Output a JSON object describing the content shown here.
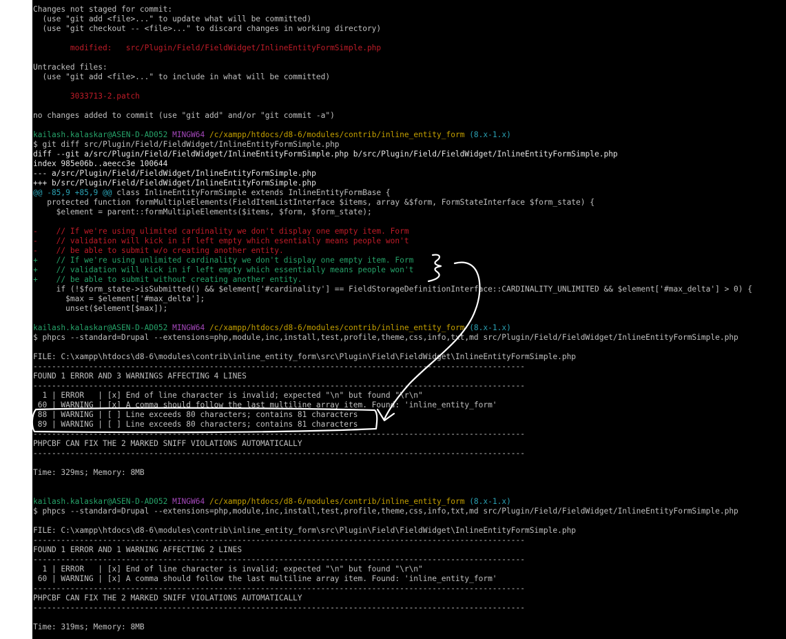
{
  "colors": {
    "background": "#000000",
    "default": "#c0c0c0",
    "red": "#c01c28",
    "green": "#26a269",
    "cyan": "#2aa1b3",
    "magenta": "#a347ba",
    "yellow": "#c4a000",
    "white": "#e6e6e6",
    "annotation": "#ffffff"
  },
  "lines": [
    {
      "segments": [
        {
          "text": "Changes not staged for commit:",
          "color": "default"
        }
      ]
    },
    {
      "segments": [
        {
          "text": "  (use \"git add <file>...\" to update what will be committed)",
          "color": "default"
        }
      ]
    },
    {
      "segments": [
        {
          "text": "  (use \"git checkout -- <file>...\" to discard changes in working directory)",
          "color": "default"
        }
      ]
    },
    {
      "segments": []
    },
    {
      "segments": [
        {
          "text": "        modified:   src/Plugin/Field/FieldWidget/InlineEntityFormSimple.php",
          "color": "red"
        }
      ]
    },
    {
      "segments": []
    },
    {
      "segments": [
        {
          "text": "Untracked files:",
          "color": "default"
        }
      ]
    },
    {
      "segments": [
        {
          "text": "  (use \"git add <file>...\" to include in what will be committed)",
          "color": "default"
        }
      ]
    },
    {
      "segments": []
    },
    {
      "segments": [
        {
          "text": "        3033713-2.patch",
          "color": "red"
        }
      ]
    },
    {
      "segments": []
    },
    {
      "segments": [
        {
          "text": "no changes added to commit (use \"git add\" and/or \"git commit -a\")",
          "color": "default"
        }
      ]
    },
    {
      "segments": []
    },
    {
      "segments": [
        {
          "text": "kailash.kalaskar@ASEN-D-AD052",
          "color": "green"
        },
        {
          "text": " ",
          "color": "default"
        },
        {
          "text": "MINGW64",
          "color": "magenta"
        },
        {
          "text": " ",
          "color": "default"
        },
        {
          "text": "/c/xampp/htdocs/d8-6/modules/contrib/inline_entity_form",
          "color": "yellow"
        },
        {
          "text": " ",
          "color": "default"
        },
        {
          "text": "(8.x-1.x)",
          "color": "cyan"
        }
      ]
    },
    {
      "segments": [
        {
          "text": "$ git diff src/Plugin/Field/FieldWidget/InlineEntityFormSimple.php",
          "color": "default"
        }
      ]
    },
    {
      "segments": [
        {
          "text": "diff --git a/src/Plugin/Field/FieldWidget/InlineEntityFormSimple.php b/src/Plugin/Field/FieldWidget/InlineEntityFormSimple.php",
          "color": "white"
        }
      ]
    },
    {
      "segments": [
        {
          "text": "index 985e06b..aeecc3e 100644",
          "color": "white"
        }
      ]
    },
    {
      "segments": [
        {
          "text": "--- a/src/Plugin/Field/FieldWidget/InlineEntityFormSimple.php",
          "color": "white"
        }
      ]
    },
    {
      "segments": [
        {
          "text": "+++ b/src/Plugin/Field/FieldWidget/InlineEntityFormSimple.php",
          "color": "white"
        }
      ]
    },
    {
      "segments": [
        {
          "text": "@@ -85,9 +85,9 @@",
          "color": "cyan"
        },
        {
          "text": " class InlineEntityFormSimple extends InlineEntityFormBase {",
          "color": "default"
        }
      ]
    },
    {
      "segments": [
        {
          "text": "   protected function formMultipleElements(FieldItemListInterface $items, array &$form, FormStateInterface $form_state) {",
          "color": "default"
        }
      ]
    },
    {
      "segments": [
        {
          "text": "     $element = parent::formMultipleElements($items, $form, $form_state);",
          "color": "default"
        }
      ]
    },
    {
      "segments": []
    },
    {
      "segments": [
        {
          "text": "-    // If we're using ulimited cardinality we don't display one empty item. Form",
          "color": "red"
        }
      ]
    },
    {
      "segments": [
        {
          "text": "-    // validation will kick in if left empty which esentially means people won't",
          "color": "red"
        }
      ]
    },
    {
      "segments": [
        {
          "text": "-    // be able to submit w/o creating another entity.",
          "color": "red"
        }
      ]
    },
    {
      "segments": [
        {
          "text": "+    // If we're using unlimited cardinality we don't display one empty item. Form",
          "color": "green"
        }
      ]
    },
    {
      "segments": [
        {
          "text": "+    // validation will kick in if left empty which essentially means people won't",
          "color": "green"
        }
      ]
    },
    {
      "segments": [
        {
          "text": "+    // be able to submit without creating another entity.",
          "color": "green"
        }
      ]
    },
    {
      "segments": [
        {
          "text": "     if (!$form_state->isSubmitted() && $element['#cardinality'] == FieldStorageDefinitionInterface::CARDINALITY_UNLIMITED && $element['#max_delta'] > 0) {",
          "color": "default"
        }
      ]
    },
    {
      "segments": [
        {
          "text": "       $max = $element['#max_delta'];",
          "color": "default"
        }
      ]
    },
    {
      "segments": [
        {
          "text": "       unset($element[$max]);",
          "color": "default"
        }
      ]
    },
    {
      "segments": []
    },
    {
      "segments": [
        {
          "text": "kailash.kalaskar@ASEN-D-AD052",
          "color": "green"
        },
        {
          "text": " ",
          "color": "default"
        },
        {
          "text": "MINGW64",
          "color": "magenta"
        },
        {
          "text": " ",
          "color": "default"
        },
        {
          "text": "/c/xampp/htdocs/d8-6/modules/contrib/inline_entity_form",
          "color": "yellow"
        },
        {
          "text": " ",
          "color": "default"
        },
        {
          "text": "(8.x-1.x)",
          "color": "cyan"
        }
      ]
    },
    {
      "segments": [
        {
          "text": "$ phpcs --standard=Drupal --extensions=php,module,inc,install,test,profile,theme,css,info,txt,md src/Plugin/Field/FieldWidget/InlineEntityFormSimple.php",
          "color": "default"
        }
      ]
    },
    {
      "segments": []
    },
    {
      "segments": [
        {
          "text": "FILE: C:\\xampp\\htdocs\\d8-6\\modules\\contrib\\inline_entity_form\\src\\Plugin\\Field\\FieldWidget\\InlineEntityFormSimple.php",
          "color": "default"
        }
      ]
    },
    {
      "segments": [
        {
          "text": "----------------------------------------------------------------------------------------------------------",
          "color": "default"
        }
      ]
    },
    {
      "segments": [
        {
          "text": "FOUND 1 ERROR AND 3 WARNINGS AFFECTING 4 LINES",
          "color": "default"
        }
      ]
    },
    {
      "segments": [
        {
          "text": "----------------------------------------------------------------------------------------------------------",
          "color": "default"
        }
      ]
    },
    {
      "segments": [
        {
          "text": "  1 | ERROR   | [x] End of line character is invalid; expected \"\\n\" but found \"\\r\\n\"",
          "color": "default"
        }
      ]
    },
    {
      "segments": [
        {
          "text": " 60 | WARNING | [x] A comma should follow the last multiline array item. Found: 'inline_entity_form'",
          "color": "default"
        }
      ]
    },
    {
      "segments": [
        {
          "text": " 88 | WARNING | [ ] Line exceeds 80 characters; contains 81 characters",
          "color": "default"
        }
      ]
    },
    {
      "segments": [
        {
          "text": " 89 | WARNING | [ ] Line exceeds 80 characters; contains 81 characters",
          "color": "default"
        }
      ]
    },
    {
      "segments": [
        {
          "text": "----------------------------------------------------------------------------------------------------------",
          "color": "default"
        }
      ]
    },
    {
      "segments": [
        {
          "text": "PHPCBF CAN FIX THE 2 MARKED SNIFF VIOLATIONS AUTOMATICALLY",
          "color": "default"
        }
      ]
    },
    {
      "segments": [
        {
          "text": "----------------------------------------------------------------------------------------------------------",
          "color": "default"
        }
      ]
    },
    {
      "segments": []
    },
    {
      "segments": [
        {
          "text": "Time: 329ms; Memory: 8MB",
          "color": "default"
        }
      ]
    },
    {
      "segments": []
    },
    {
      "segments": []
    },
    {
      "segments": [
        {
          "text": "kailash.kalaskar@ASEN-D-AD052",
          "color": "green"
        },
        {
          "text": " ",
          "color": "default"
        },
        {
          "text": "MINGW64",
          "color": "magenta"
        },
        {
          "text": " ",
          "color": "default"
        },
        {
          "text": "/c/xampp/htdocs/d8-6/modules/contrib/inline_entity_form",
          "color": "yellow"
        },
        {
          "text": " ",
          "color": "default"
        },
        {
          "text": "(8.x-1.x)",
          "color": "cyan"
        }
      ]
    },
    {
      "segments": [
        {
          "text": "$ phpcs --standard=Drupal --extensions=php,module,inc,install,test,profile,theme,css,info,txt,md src/Plugin/Field/FieldWidget/InlineEntityFormSimple.php",
          "color": "default"
        }
      ]
    },
    {
      "segments": []
    },
    {
      "segments": [
        {
          "text": "FILE: C:\\xampp\\htdocs\\d8-6\\modules\\contrib\\inline_entity_form\\src\\Plugin\\Field\\FieldWidget\\InlineEntityFormSimple.php",
          "color": "default"
        }
      ]
    },
    {
      "segments": [
        {
          "text": "----------------------------------------------------------------------------------------------------------",
          "color": "default"
        }
      ]
    },
    {
      "segments": [
        {
          "text": "FOUND 1 ERROR AND 1 WARNING AFFECTING 2 LINES",
          "color": "default"
        }
      ]
    },
    {
      "segments": [
        {
          "text": "----------------------------------------------------------------------------------------------------------",
          "color": "default"
        }
      ]
    },
    {
      "segments": [
        {
          "text": "  1 | ERROR   | [x] End of line character is invalid; expected \"\\n\" but found \"\\r\\n\"",
          "color": "default"
        }
      ]
    },
    {
      "segments": [
        {
          "text": " 60 | WARNING | [x] A comma should follow the last multiline array item. Found: 'inline_entity_form'",
          "color": "default"
        }
      ]
    },
    {
      "segments": [
        {
          "text": "----------------------------------------------------------------------------------------------------------",
          "color": "default"
        }
      ]
    },
    {
      "segments": [
        {
          "text": "PHPCBF CAN FIX THE 2 MARKED SNIFF VIOLATIONS AUTOMATICALLY",
          "color": "default"
        }
      ]
    },
    {
      "segments": [
        {
          "text": "----------------------------------------------------------------------------------------------------------",
          "color": "default"
        }
      ]
    },
    {
      "segments": []
    },
    {
      "segments": [
        {
          "text": "Time: 319ms; Memory: 8MB",
          "color": "default"
        }
      ]
    }
  ]
}
